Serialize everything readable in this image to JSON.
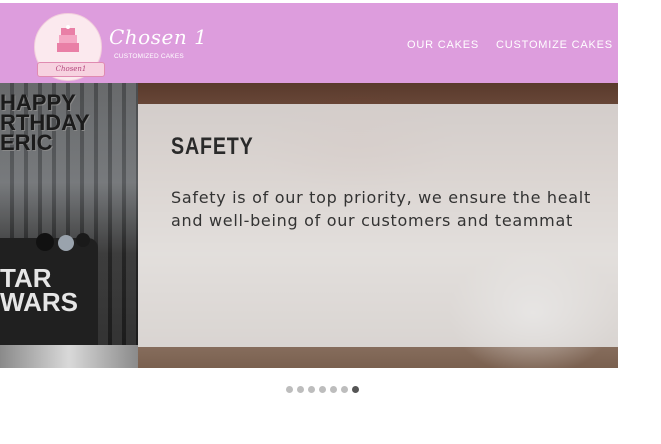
{
  "header": {
    "brand_name": "Chosen 1",
    "brand_tagline": "CUSTOMIZED CAKES",
    "logo_ribbon": "Chosen1",
    "nav": [
      "OUR CAKES",
      "CUSTOMIZE CAKES"
    ],
    "background_color": "#dd9ddd"
  },
  "hero": {
    "image_topper_text": [
      "HAPPY",
      "RTHDAY",
      "ERIC"
    ],
    "image_cake_text": [
      "TAR",
      "WARS"
    ],
    "title": "SAFETY",
    "text_lines": [
      "Safety is of our top priority, we ensure the healt",
      "and well-being of our customers and teammat"
    ]
  },
  "carousel": {
    "dot_count": 7,
    "active_index": 6
  }
}
